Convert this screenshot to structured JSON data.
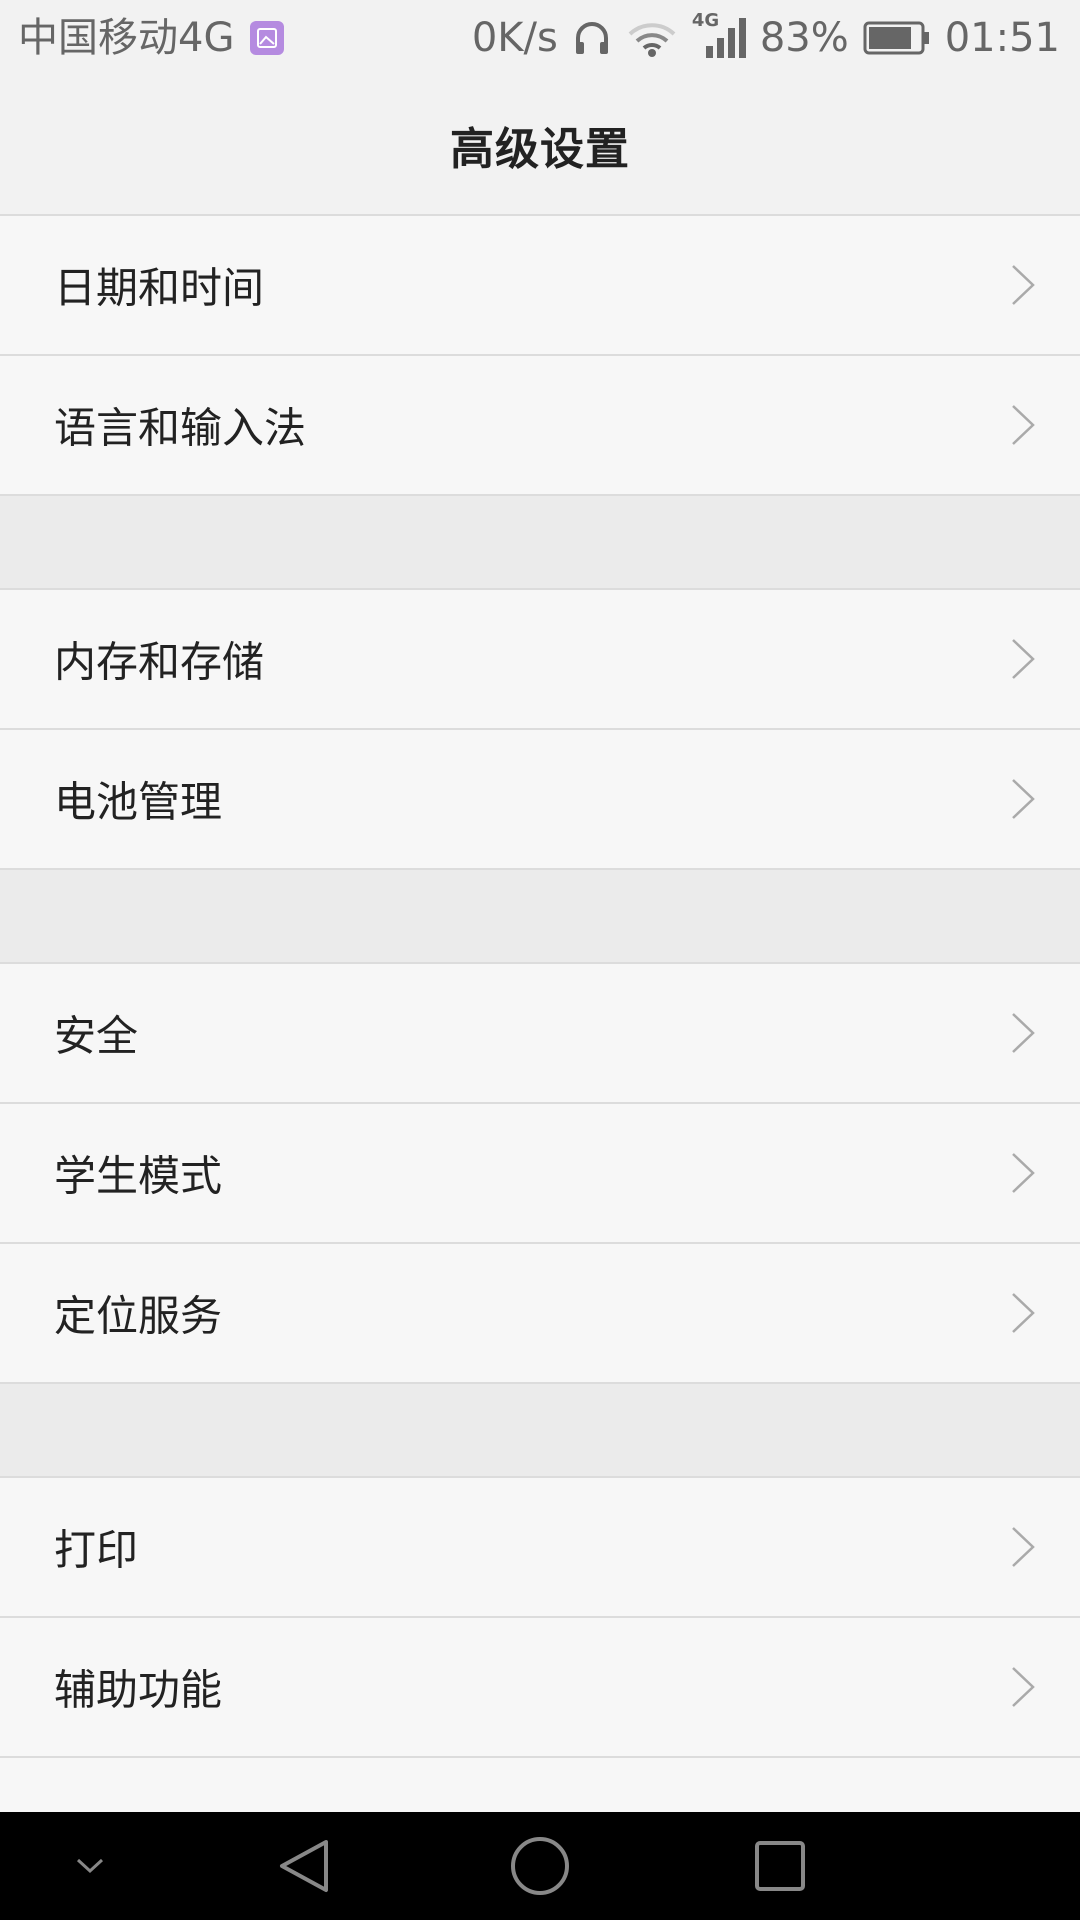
{
  "status_bar": {
    "carrier": "中国移动4G",
    "speed": "0K/s",
    "network_type": "4G",
    "battery_percent": "83%",
    "time": "01:51"
  },
  "header": {
    "title": "高级设置"
  },
  "settings": {
    "group1": [
      {
        "label": "日期和时间"
      },
      {
        "label": "语言和输入法"
      }
    ],
    "group2": [
      {
        "label": "内存和存储"
      },
      {
        "label": "电池管理"
      }
    ],
    "group3": [
      {
        "label": "安全"
      },
      {
        "label": "学生模式"
      },
      {
        "label": "定位服务"
      }
    ],
    "group4": [
      {
        "label": "打印"
      },
      {
        "label": "辅助功能"
      }
    ]
  },
  "nav_bar": {
    "buttons": [
      "chevron-down-icon",
      "back-icon",
      "home-icon",
      "recents-icon"
    ]
  },
  "colors": {
    "status_bar_bg": "#f2f2f2",
    "list_bg": "#f7f7f7",
    "group_gap_bg": "#ebebeb",
    "nav_bar_bg": "#000000",
    "gallery_badge": "#b58be0"
  }
}
